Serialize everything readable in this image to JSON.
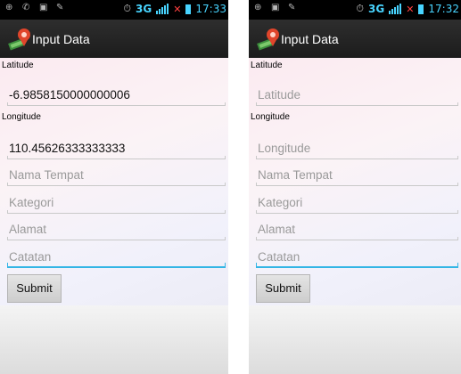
{
  "screens": [
    {
      "status_bar": {
        "time": "17:33",
        "network": "3G"
      },
      "action_bar": {
        "title": "Input Data"
      },
      "form": {
        "latitude_label": "Latitude",
        "latitude_value": "-6.9858150000000006",
        "longitude_label": "Longitude",
        "longitude_value": "110.45626333333333",
        "nama_tempat_placeholder": "Nama Tempat",
        "kategori_placeholder": "Kategori",
        "alamat_placeholder": "Alamat",
        "catatan_placeholder": "Catatan",
        "submit_label": "Submit"
      }
    },
    {
      "status_bar": {
        "time": "17:32",
        "network": "3G"
      },
      "action_bar": {
        "title": "Input Data"
      },
      "form": {
        "latitude_label": "Latitude",
        "latitude_placeholder": "Latitude",
        "longitude_label": "Longitude",
        "longitude_placeholder": "Longitude",
        "nama_tempat_placeholder": "Nama Tempat",
        "kategori_placeholder": "Kategori",
        "alamat_placeholder": "Alamat",
        "catatan_placeholder": "Catatan",
        "submit_label": "Submit"
      }
    }
  ],
  "colors": {
    "focus_accent": "#33b5e5",
    "status_text": "#48d4ff",
    "action_bar_bg": "#1c1c1c"
  }
}
